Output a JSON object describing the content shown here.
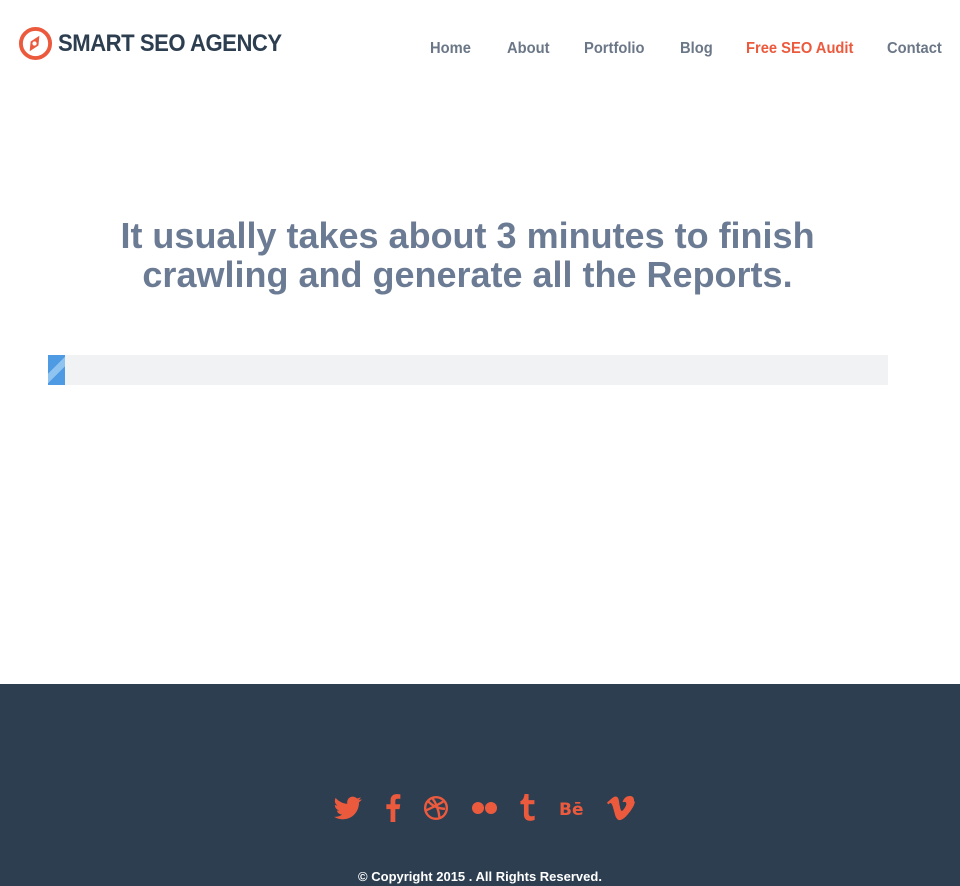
{
  "brand": {
    "name": "SMART SEO AGENCY",
    "accent_color": "#ec5a3e",
    "logo_icon": "compass-icon"
  },
  "nav": {
    "items": [
      {
        "label": "Home"
      },
      {
        "label": "About"
      },
      {
        "label": "Portfolio"
      },
      {
        "label": "Blog"
      },
      {
        "label": "Free SEO Audit",
        "active": true
      },
      {
        "label": "Contact"
      }
    ]
  },
  "main": {
    "headline": "It usually takes about 3 minutes to finish crawling and generate all the Reports.",
    "progress": {
      "percent": 2,
      "fill_color": "#4f9be3"
    }
  },
  "footer": {
    "background_color": "#2c3e50",
    "social": [
      {
        "icon": "twitter-icon"
      },
      {
        "icon": "facebook-icon"
      },
      {
        "icon": "dribbble-icon"
      },
      {
        "icon": "flickr-icon"
      },
      {
        "icon": "tumblr-icon"
      },
      {
        "icon": "behance-icon"
      },
      {
        "icon": "vimeo-icon"
      }
    ],
    "copyright": "© Copyright 2015 . All Rights Reserved."
  }
}
